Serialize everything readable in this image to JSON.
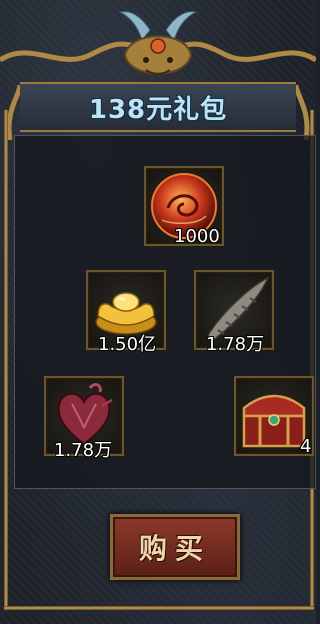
{
  "title": "138元礼包",
  "items": [
    {
      "icon": "dragon-orb-icon",
      "quantity": "1000"
    },
    {
      "icon": "gold-ingot-icon",
      "quantity": "1.50亿"
    },
    {
      "icon": "horn-icon",
      "quantity": "1.78万"
    },
    {
      "icon": "heart-icon",
      "quantity": "1.78万"
    },
    {
      "icon": "treasure-chest-icon",
      "quantity": "4"
    }
  ],
  "buy_button": {
    "label": "购买"
  },
  "colors": {
    "frame_gold": "#c9a45a",
    "title_blue": "#bfe3f5",
    "button_red": "#8d3a2a"
  }
}
